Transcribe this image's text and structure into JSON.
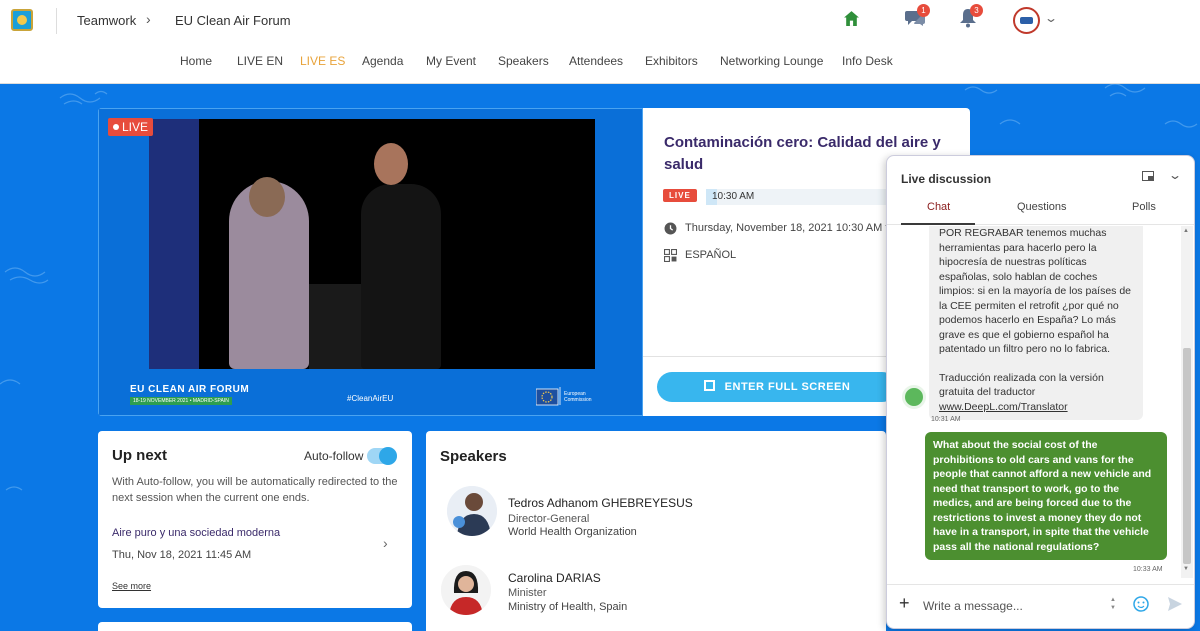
{
  "header": {
    "crumb_root": "Teamwork",
    "crumb_current": "EU Clean Air Forum",
    "chat_badge": "1",
    "notif_badge": "3"
  },
  "nav": [
    "Home",
    "LIVE EN",
    "LIVE ES",
    "Agenda",
    "My Event",
    "Speakers",
    "Attendees",
    "Exhibitors",
    "Networking Lounge",
    "Info Desk"
  ],
  "nav_active": "LIVE ES",
  "video": {
    "live_tag": "LIVE",
    "forum_title": "EU CLEAN AIR FORUM",
    "forum_date": "18-19 NOVEMBER 2021 • MADRID-SPAIN",
    "hashtag": "#CleanAirEU",
    "ec_line1": "European",
    "ec_line2": "Commission"
  },
  "session": {
    "title": "Contaminación cero: Calidad del aire y salud",
    "live_pill": "LIVE",
    "progress_time": "10:30 AM",
    "progress_fraction": 0.06,
    "datetime": "Thursday, November 18, 2021 10:30 AM t",
    "language": "ESPAÑOL",
    "fullscreen_label": "ENTER FULL SCREEN"
  },
  "upnext": {
    "title": "Up next",
    "autofollow_label": "Auto-follow",
    "autofollow_on": true,
    "description": "With Auto-follow, you will be automatically redirected to the next session when the current one ends.",
    "next_title": "Aire puro y una sociedad moderna",
    "next_time": "Thu, Nov 18, 2021 11:45 AM",
    "see_more": "See more"
  },
  "speakers": {
    "title": "Speakers",
    "items": [
      {
        "name": "Tedros Adhanom GHEBREYESUS",
        "role": "Director-General",
        "org": "World Health Organization"
      },
      {
        "name": "Carolina DARIAS",
        "role": "Minister",
        "org": "Ministry of Health, Spain"
      }
    ]
  },
  "chat": {
    "title": "Live discussion",
    "tabs": [
      "Chat",
      "Questions",
      "Polls"
    ],
    "active_tab": "Chat",
    "incoming_lines": [
      "POR REGRABAR tenemos muchas",
      "herramientas para hacerlo pero la",
      "hipocresía de nuestras políticas",
      "españolas, solo hablan de coches",
      "limpios: si en la mayoría de los países de",
      "la CEE permiten el retrofit ¿por qué no",
      "podemos hacerlo en España? Lo más",
      "grave es que el gobierno español ha",
      "patentado un filtro pero no lo fabrica."
    ],
    "incoming_footer1": "Traducción realizada con la versión",
    "incoming_footer2": "gratuita del traductor",
    "incoming_link": "www.DeepL.com/Translator",
    "incoming_time": "10:31 AM",
    "outgoing_text": "What about the social cost of the prohibitions to old cars and vans for the people that cannot afford a new vehicle and need that transport to work, go to the medics, and are being forced due to the restrictions to invest a money they do not have in a transport, in spite that the vehicle pass all the national regulations?",
    "outgoing_time": "10:33 AM",
    "input_placeholder": "Write a message..."
  },
  "colors": {
    "background": "#0b78e6",
    "accent": "#38b6ee",
    "live": "#e74c3c",
    "nav_active": "#e8a33a",
    "outgoing_bubble": "#4c8f30"
  }
}
